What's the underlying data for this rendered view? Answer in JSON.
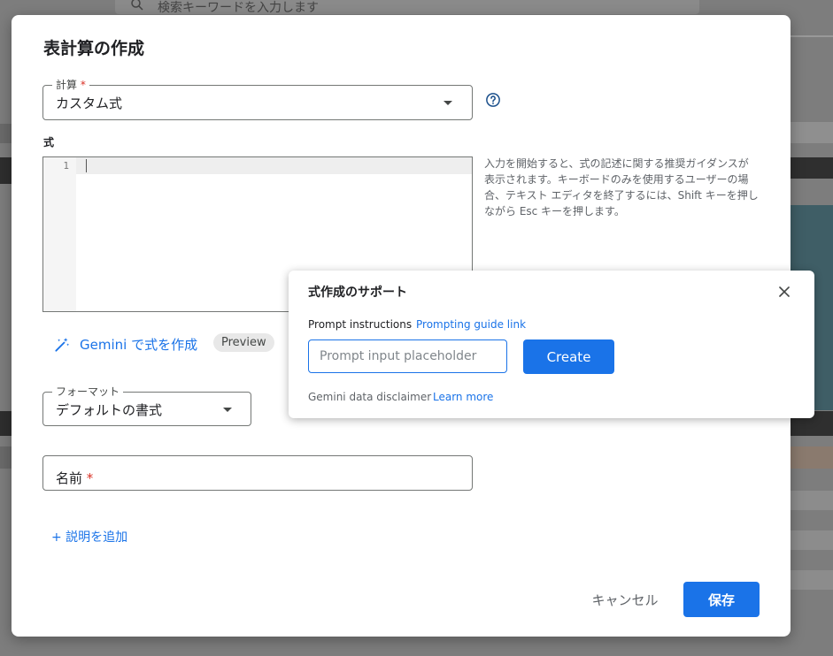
{
  "background": {
    "search_placeholder": "検索キーワードを入力します"
  },
  "dialog": {
    "title": "表計算の作成",
    "calculation": {
      "label": "計算",
      "required_mark": "*",
      "value": "カスタム式"
    },
    "formula": {
      "label": "式",
      "line_number": "1",
      "help_text": "入力を開始すると、式の記述に関する推奨ガイダンスが表示されます。キーボードのみを使用するユーザーの場合、テキスト エディタを終了するには、Shift キーを押しながら Esc キーを押します。"
    },
    "gemini": {
      "label": "Gemini で式を作成",
      "chip": "Preview"
    },
    "format": {
      "label": "フォーマット",
      "value": "デフォルトの書式"
    },
    "name": {
      "label": "名前",
      "required_mark": "*"
    },
    "add_description": "+ 説明を追加",
    "cancel_label": "キャンセル",
    "save_label": "保存"
  },
  "popover": {
    "title": "式作成のサポート",
    "instructions_label": "Prompt instructions",
    "guide_link": "Prompting guide link",
    "input_placeholder": "Prompt input placeholder",
    "create_label": "Create",
    "disclaimer": "Gemini data disclaimer",
    "learn_more": "Learn more"
  },
  "colors": {
    "accent": "#1a73e8",
    "required": "#d93025"
  }
}
